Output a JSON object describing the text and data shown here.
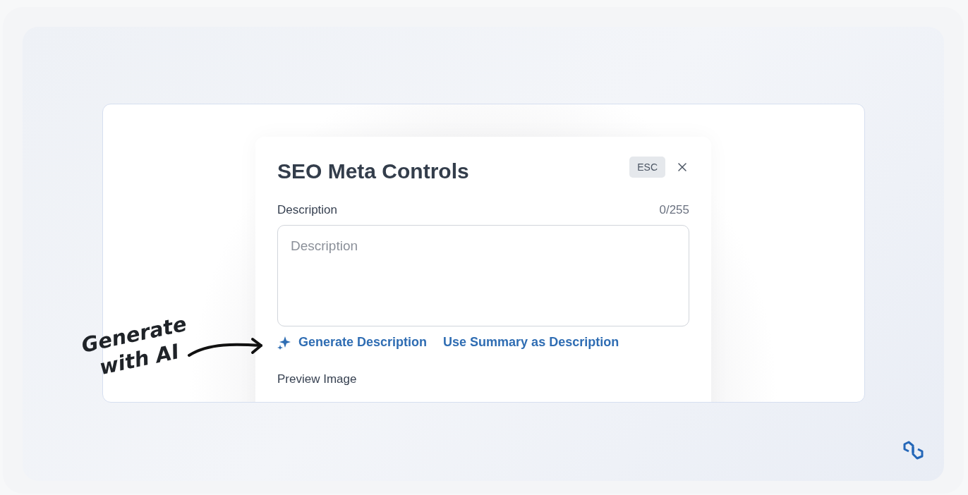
{
  "modal": {
    "title": "SEO Meta Controls",
    "esc_key": "ESC",
    "description": {
      "label": "Description",
      "counter": "0/255",
      "placeholder": "Description"
    },
    "actions": [
      {
        "kind": "ai",
        "label": "Generate Description"
      },
      {
        "kind": "plain",
        "label": "Use Summary as Description"
      }
    ],
    "next_section": "Preview Image"
  },
  "annotation": {
    "lines": [
      "Generate",
      "with AI"
    ]
  }
}
